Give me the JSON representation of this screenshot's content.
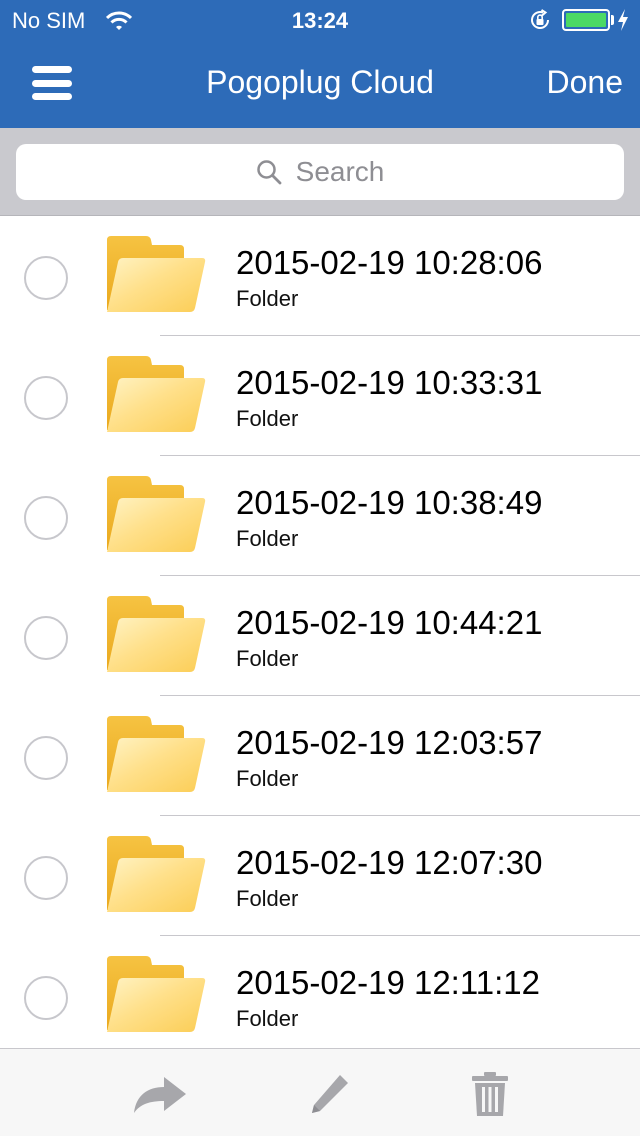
{
  "status_bar": {
    "carrier": "No SIM",
    "time": "13:24",
    "battery_color": "#4cd964"
  },
  "nav": {
    "title": "Pogoplug Cloud",
    "done_label": "Done",
    "bar_color": "#2d6bb8",
    "menu_icon": "hamburger-menu-icon"
  },
  "search": {
    "placeholder": "Search",
    "icon": "search-icon"
  },
  "files": [
    {
      "name": "2015-02-19 10:28:06",
      "type": "Folder",
      "icon": "folder-icon"
    },
    {
      "name": "2015-02-19 10:33:31",
      "type": "Folder",
      "icon": "folder-icon"
    },
    {
      "name": "2015-02-19 10:38:49",
      "type": "Folder",
      "icon": "folder-icon"
    },
    {
      "name": "2015-02-19 10:44:21",
      "type": "Folder",
      "icon": "folder-icon"
    },
    {
      "name": "2015-02-19 12:03:57",
      "type": "Folder",
      "icon": "folder-icon"
    },
    {
      "name": "2015-02-19 12:07:30",
      "type": "Folder",
      "icon": "folder-icon"
    },
    {
      "name": "2015-02-19 12:11:12",
      "type": "Folder",
      "icon": "folder-icon"
    }
  ],
  "toolbar": {
    "icons": [
      "share-icon",
      "pencil-icon",
      "trash-icon"
    ],
    "enabled": false
  }
}
